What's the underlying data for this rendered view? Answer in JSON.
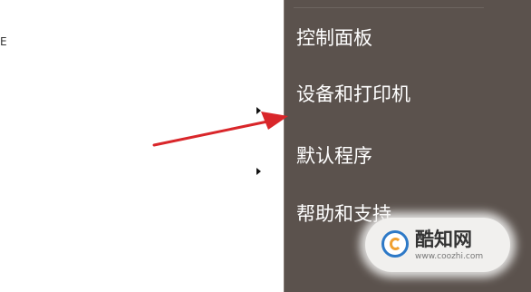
{
  "left_edge_glyph": "E",
  "menu": {
    "items": [
      {
        "label": "控制面板"
      },
      {
        "label": "设备和打印机"
      },
      {
        "label": "默认程序"
      },
      {
        "label": "帮助和支持"
      }
    ]
  },
  "annotation": {
    "arrow_color": "#d9262a"
  },
  "watermark": {
    "title": "酷知网",
    "url": "www.coozhi.com"
  },
  "colors": {
    "menu_bg": "#5b524d",
    "menu_text": "#ffffff"
  }
}
